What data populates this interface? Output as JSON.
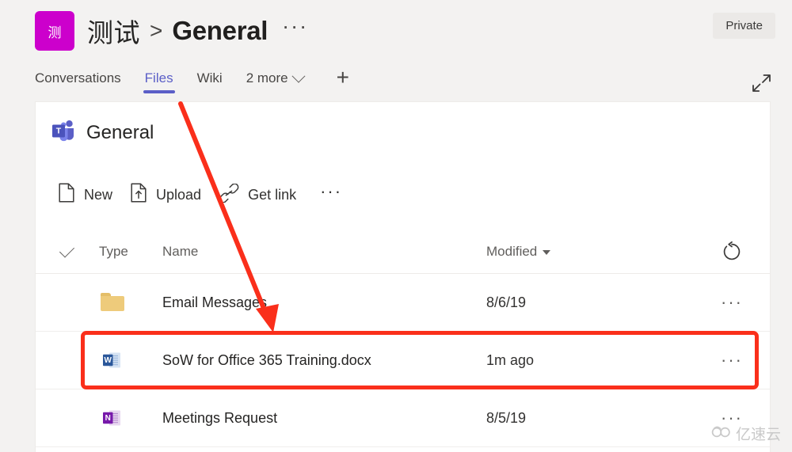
{
  "header": {
    "team_initial": "测",
    "team_name": "测试",
    "separator": ">",
    "channel_name": "General",
    "more_options": "···",
    "privacy_badge": "Private",
    "avatar_color": "#cc00cc",
    "expand_icon": "expand-icon"
  },
  "tabs": {
    "items": [
      {
        "label": "Conversations",
        "active": false
      },
      {
        "label": "Files",
        "active": true
      },
      {
        "label": "Wiki",
        "active": false
      }
    ],
    "more_label": "2 more",
    "add_label": "+",
    "accent_color": "#5b5fc7"
  },
  "panel": {
    "title": "General",
    "title_icon": "teams-logo-icon",
    "commands": [
      {
        "label": "New",
        "icon": "new-document-icon"
      },
      {
        "label": "Upload",
        "icon": "upload-icon"
      },
      {
        "label": "Get link",
        "icon": "link-icon"
      }
    ],
    "overflow_label": "···",
    "columns": {
      "select_all": "select-all-checkmark",
      "type": "Type",
      "name": "Name",
      "modified": "Modified",
      "sort_indicator": "sort-descending-caret",
      "refresh": "refresh-icon"
    },
    "rows": [
      {
        "icon": "folder-icon",
        "name": "Email Messages",
        "modified": "8/6/19",
        "actions": "···",
        "highlighted": false
      },
      {
        "icon": "word-document-icon",
        "name": "SoW for Office 365 Training.docx",
        "modified": "1m ago",
        "actions": "···",
        "highlighted": true
      },
      {
        "icon": "onenote-icon",
        "name": "Meetings Request",
        "modified": "8/5/19",
        "actions": "···",
        "highlighted": false
      }
    ]
  },
  "annotations": {
    "highlight_color": "#fa2f1b",
    "box_target": "SoW for Office 365 Training.docx",
    "arrow": "red-arrow-pointing-to-file-row"
  },
  "watermark": {
    "text": "亿速云",
    "icon": "cloud-logo-icon"
  }
}
